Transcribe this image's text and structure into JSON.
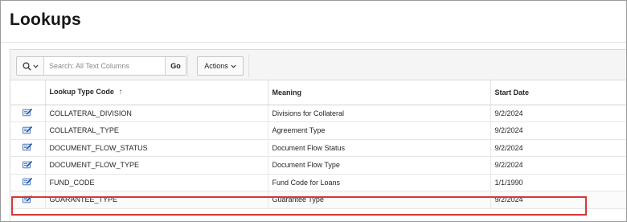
{
  "page": {
    "title": "Lookups"
  },
  "toolbar": {
    "search_placeholder": "Search: All Text Columns",
    "go_label": "Go",
    "actions_label": "Actions",
    "search_icon": "search-icon",
    "chevron_icon": "chevron-down-icon"
  },
  "table": {
    "columns": [
      "",
      "Lookup Type Code",
      "Meaning",
      "Start Date"
    ],
    "sort_indicator": "↑",
    "rows": [
      {
        "code": "COLLATERAL_DIVISION",
        "meaning": "Divisions for Collateral",
        "start_date": "9/2/2024"
      },
      {
        "code": "COLLATERAL_TYPE",
        "meaning": "Agreement Type",
        "start_date": "9/2/2024"
      },
      {
        "code": "DOCUMENT_FLOW_STATUS",
        "meaning": "Document Flow Status",
        "start_date": "9/2/2024"
      },
      {
        "code": "DOCUMENT_FLOW_TYPE",
        "meaning": "Document Flow Type",
        "start_date": "9/2/2024"
      },
      {
        "code": "FUND_CODE",
        "meaning": "Fund Code for Loans",
        "start_date": "1/1/1990"
      },
      {
        "code": "GUARANTEE_TYPE",
        "meaning": "Guarantee Type",
        "start_date": "9/2/2024"
      }
    ]
  },
  "colors": {
    "highlight": "#d63838",
    "edit_icon": "#3a6fb5"
  }
}
